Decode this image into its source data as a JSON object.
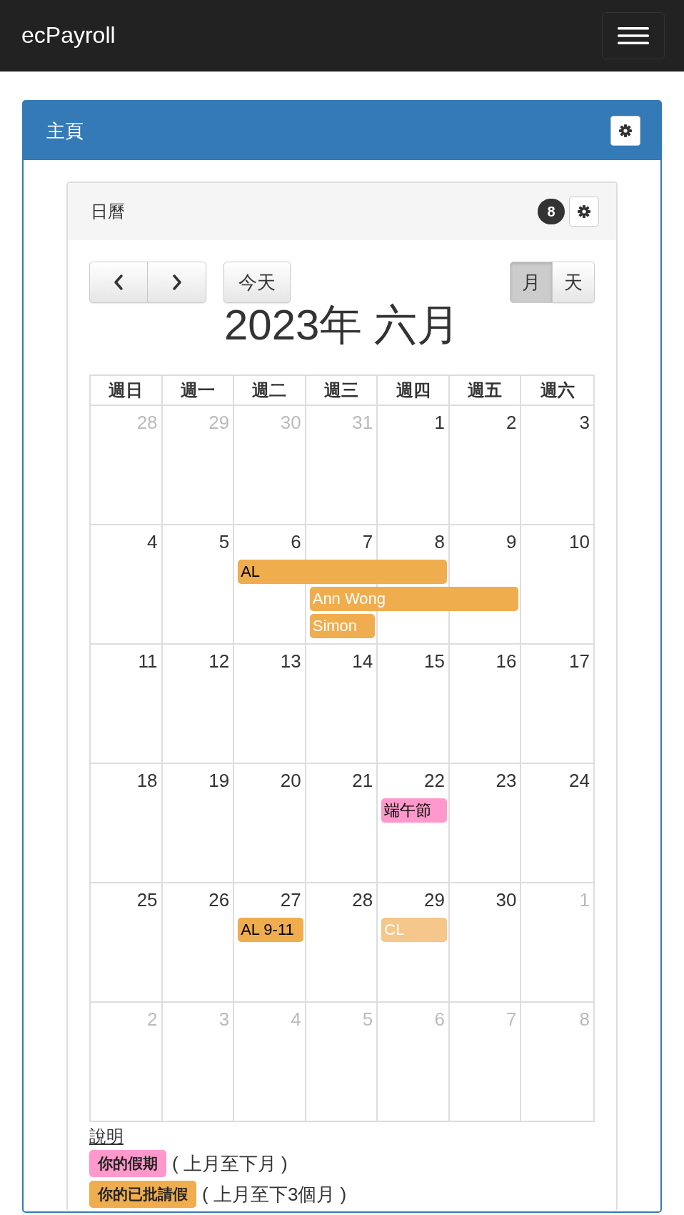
{
  "navbar": {
    "brand": "ecPayroll"
  },
  "panel": {
    "title": "主頁"
  },
  "calendar_card": {
    "title": "日曆",
    "badge": "8"
  },
  "toolbar": {
    "today": "今天",
    "views": [
      {
        "label": "月",
        "selected": true
      },
      {
        "label": "天",
        "selected": false
      }
    ]
  },
  "calendar_title": "2023年 六月",
  "weekdays": [
    "週日",
    "週一",
    "週二",
    "週三",
    "週四",
    "週五",
    "週六"
  ],
  "weeks": [
    {
      "days": [
        {
          "day": "28",
          "other_month": true
        },
        {
          "day": "29",
          "other_month": true
        },
        {
          "day": "30",
          "other_month": true
        },
        {
          "day": "31",
          "other_month": true
        },
        {
          "day": "1",
          "other_month": false
        },
        {
          "day": "2",
          "other_month": false
        },
        {
          "day": "3",
          "other_month": false
        }
      ]
    },
    {
      "days": [
        {
          "day": "4",
          "other_month": false
        },
        {
          "day": "5",
          "other_month": false
        },
        {
          "day": "6",
          "other_month": false
        },
        {
          "day": "7",
          "other_month": false
        },
        {
          "day": "8",
          "other_month": false
        },
        {
          "day": "9",
          "other_month": false
        },
        {
          "day": "10",
          "other_month": false
        }
      ],
      "events": [
        {
          "title": "AL",
          "kind": "dark",
          "color": "#f0ad4e"
        },
        {
          "title": "Ann Wong",
          "kind": "light",
          "color": "#f0ad4e"
        },
        {
          "title": "Simon",
          "kind": "light",
          "color": "#f0ad4e"
        }
      ]
    },
    {
      "days": [
        {
          "day": "11",
          "other_month": false
        },
        {
          "day": "12",
          "other_month": false
        },
        {
          "day": "13",
          "other_month": false
        },
        {
          "day": "14",
          "other_month": false
        },
        {
          "day": "15",
          "other_month": false
        },
        {
          "day": "16",
          "other_month": false
        },
        {
          "day": "17",
          "other_month": false
        }
      ]
    },
    {
      "days": [
        {
          "day": "18",
          "other_month": false
        },
        {
          "day": "19",
          "other_month": false
        },
        {
          "day": "20",
          "other_month": false
        },
        {
          "day": "21",
          "other_month": false
        },
        {
          "day": "22",
          "other_month": false
        },
        {
          "day": "23",
          "other_month": false
        },
        {
          "day": "24",
          "other_month": false
        }
      ],
      "events": [
        {
          "title": "端午節",
          "kind": "dark",
          "color": "#ff99cc"
        }
      ]
    },
    {
      "days": [
        {
          "day": "25",
          "other_month": false
        },
        {
          "day": "26",
          "other_month": false
        },
        {
          "day": "27",
          "other_month": false
        },
        {
          "day": "28",
          "other_month": false
        },
        {
          "day": "29",
          "other_month": false
        },
        {
          "day": "30",
          "other_month": false
        },
        {
          "day": "1",
          "other_month": true
        }
      ],
      "events": [
        {
          "title": "AL 9-11",
          "kind": "dark",
          "color": "#f0ad4e"
        },
        {
          "title": "CL",
          "kind": "light",
          "color": "#f5c78a"
        }
      ]
    },
    {
      "days": [
        {
          "day": "2",
          "other_month": true
        },
        {
          "day": "3",
          "other_month": true
        },
        {
          "day": "4",
          "other_month": true
        },
        {
          "day": "5",
          "other_month": true
        },
        {
          "day": "6",
          "other_month": true
        },
        {
          "day": "7",
          "other_month": true
        },
        {
          "day": "8",
          "other_month": true
        }
      ]
    }
  ],
  "legend": {
    "title": "說明",
    "items": [
      {
        "label": "你的假期",
        "note": "( 上月至下月 )",
        "color": "#ff99cc"
      },
      {
        "label": "你的已批請假",
        "note": "( 上月至下3個月 )",
        "color": "#f0ad4e"
      }
    ]
  }
}
